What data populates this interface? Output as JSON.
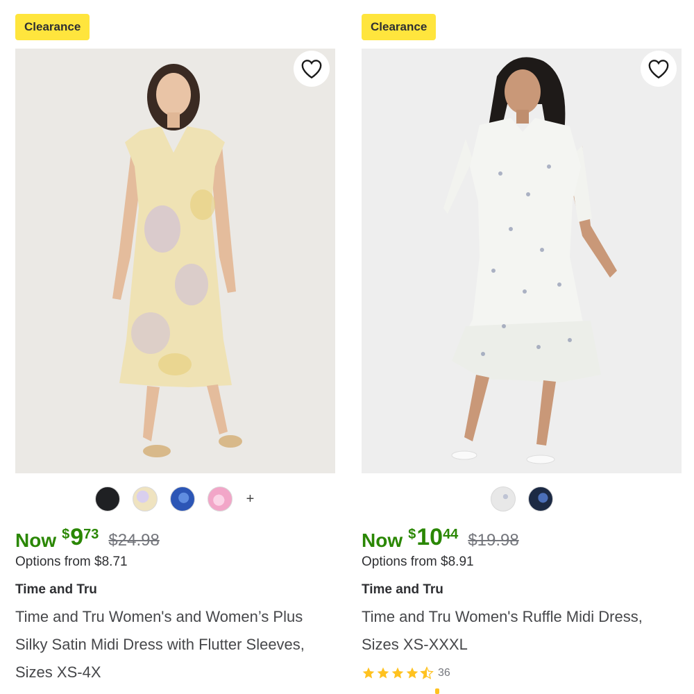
{
  "products": [
    {
      "badge": "Clearance",
      "now_label": "Now",
      "price_currency": "$",
      "price_whole": "9",
      "price_cents": "73",
      "was_price": "$24.98",
      "options_text": "Options from $8.71",
      "brand": "Time and Tru",
      "title": "Time and Tru Women's and Women’s Plus Silky Satin Midi Dress with Flutter Sleeves, Sizes XS-4X",
      "swatches": [
        {
          "name": "black",
          "color": "#1f2023"
        },
        {
          "name": "yellow-floral",
          "color": "#efe3c0"
        },
        {
          "name": "blue-print",
          "color": "#2c56b6"
        },
        {
          "name": "pink-print",
          "color": "#f2a6c8"
        }
      ],
      "more_swatches": "+",
      "photo": {
        "background": "#ebe9e5",
        "dress": "#efe2b4",
        "accent": "#c8b8e0"
      }
    },
    {
      "badge": "Clearance",
      "now_label": "Now",
      "price_currency": "$",
      "price_whole": "10",
      "price_cents": "44",
      "was_price": "$19.98",
      "options_text": "Options from $8.91",
      "brand": "Time and Tru",
      "title": "Time and Tru Women's Ruffle Midi Dress, Sizes XS-XXXL",
      "rating": 4.5,
      "review_count": "36",
      "swatches": [
        {
          "name": "white-floral",
          "color": "#e8e8e8"
        },
        {
          "name": "navy-floral",
          "color": "#1c2a44"
        }
      ],
      "photo": {
        "background": "#eeeeee",
        "dress": "#f4f5f2",
        "accent": "#8c95b0"
      }
    }
  ],
  "colors": {
    "price_green": "#2a8703",
    "badge_yellow": "#ffe53d",
    "star": "#ffc220"
  }
}
